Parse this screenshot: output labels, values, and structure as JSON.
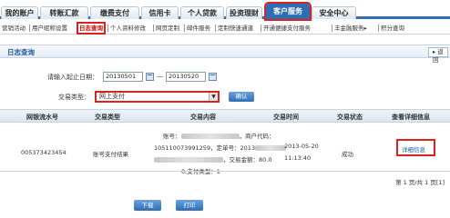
{
  "tabs": [
    {
      "label": "我的账户"
    },
    {
      "label": "转账汇款"
    },
    {
      "label": "缴费支付"
    },
    {
      "label": "信用卡"
    },
    {
      "label": "个人贷款"
    },
    {
      "label": "投资理财"
    },
    {
      "label": "客户服务"
    },
    {
      "label": "安全中心"
    }
  ],
  "submenu": [
    {
      "label": "营销活动"
    },
    {
      "label": "用户昵称设置"
    },
    {
      "label": "日志查询"
    },
    {
      "label": "个人资料修改"
    },
    {
      "label": "网页定制"
    },
    {
      "label": "邮件服务"
    },
    {
      "label": "定制快速通道"
    },
    {
      "label": "开通便捷支付服务"
    },
    {
      "label": "丰金融服务▸"
    },
    {
      "label": "积分查询"
    }
  ],
  "panel": {
    "title": "日志查询",
    "return_label": "▸ 返回"
  },
  "form": {
    "date_label": "请输入起止日期：",
    "start_date": "20130501",
    "date_sep": "—",
    "end_date": "20130520",
    "type_label": "交易类型：",
    "type_value": "网上支付",
    "confirm_label": "确认"
  },
  "table": {
    "headers": [
      "网银流水号",
      "交易类型",
      "交易内容",
      "交易时间",
      "交易状态",
      "查看详细信息"
    ],
    "row": {
      "serial": "005373423454",
      "type": "账号支付结果",
      "content_line1_prefix": "账号：",
      "content_line1_suffix": "，商户代码：",
      "content_line2_prefix": "105110073991259，定单号：2013",
      "content_line3_suffix": "，交易金额：80.0",
      "content_line4": "0,支付类型：1",
      "time_date": "2013-05-20",
      "time_clock": "11:13:40",
      "status": "成功",
      "detail_link": "详细信息"
    }
  },
  "pager": {
    "text": "第 1 页/共 1 页[1]"
  },
  "buttons": {
    "download": "下载",
    "print": "打印"
  }
}
